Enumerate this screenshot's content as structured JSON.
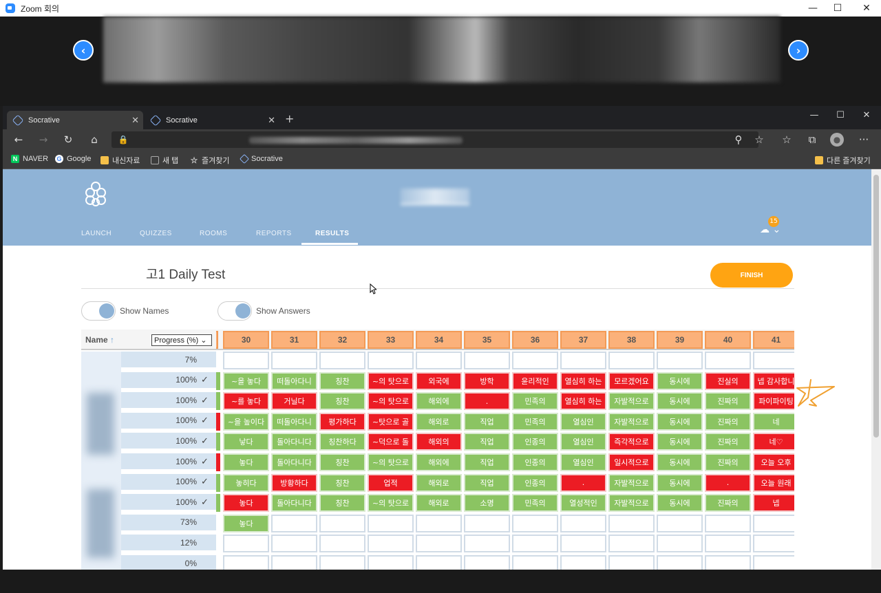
{
  "zoom": {
    "title": "Zoom 회의",
    "window_controls": {
      "minimize": "—",
      "maximize": "☐",
      "close": "✕"
    },
    "nav_prev": "‹",
    "nav_next": "›"
  },
  "browser": {
    "tabs": [
      {
        "label": "Socrative",
        "active": true
      },
      {
        "label": "Socrative",
        "active": false
      }
    ],
    "new_tab": "+",
    "toolbar_icons": [
      "back-icon",
      "forward-icon",
      "refresh-icon",
      "home-icon",
      "lock-icon",
      "search-icon",
      "star-icon",
      "favorites-icon",
      "collections-icon",
      "profile-icon",
      "more-icon"
    ],
    "bookmarks": [
      {
        "label": "NAVER",
        "icon": "naver-icon",
        "color": "#03c75a"
      },
      {
        "label": "Google",
        "icon": "google-icon",
        "color": "#4285f4"
      },
      {
        "label": "내신자료",
        "icon": "folder-icon",
        "color": "#f5c04a"
      },
      {
        "label": "새 탭",
        "icon": "newtab-icon",
        "color": "#aaaaaa"
      },
      {
        "label": "즐겨찾기",
        "icon": "star-icon",
        "color": "#cccccc"
      },
      {
        "label": "Socrative",
        "icon": "socrative-icon",
        "color": "#8ab4f8"
      }
    ],
    "other_bookmarks": "다른 즐겨찾기"
  },
  "socrative": {
    "nav": [
      {
        "label": "LAUNCH",
        "active": false
      },
      {
        "label": "QUIZZES",
        "active": false
      },
      {
        "label": "ROOMS",
        "active": false
      },
      {
        "label": "REPORTS",
        "active": false
      },
      {
        "label": "RESULTS",
        "active": true
      }
    ],
    "badge_count": "15",
    "quiz_title": "고1 Daily Test",
    "finish_label": "FINISH",
    "toggles": [
      {
        "label": "Show Names",
        "on": true
      },
      {
        "label": "Show Answers",
        "on": true
      }
    ],
    "grid": {
      "name_header": "Name",
      "sort_icon": "↑",
      "progress_select": "Progress (%)",
      "questions": [
        "30",
        "31",
        "32",
        "33",
        "34",
        "35",
        "36",
        "37",
        "38",
        "39",
        "40",
        "41"
      ],
      "rows": [
        {
          "progress": "7%",
          "check": false,
          "edge": "",
          "cells": [
            [
              "",
              ""
            ],
            [
              "",
              ""
            ],
            [
              "",
              ""
            ],
            [
              "",
              ""
            ],
            [
              "",
              ""
            ],
            [
              "",
              ""
            ],
            [
              "",
              ""
            ],
            [
              "",
              ""
            ],
            [
              "",
              ""
            ],
            [
              "",
              ""
            ],
            [
              "",
              ""
            ],
            [
              "",
              ""
            ]
          ]
        },
        {
          "progress": "100%",
          "check": true,
          "edge": "correct",
          "cells": [
            [
              "~을 놓다",
              "c"
            ],
            [
              "떠돌아다니",
              "c"
            ],
            [
              "칭찬",
              "c"
            ],
            [
              "~의 탓으로",
              "w"
            ],
            [
              "외국에",
              "w"
            ],
            [
              "방학",
              "w"
            ],
            [
              "윤리적인",
              "w"
            ],
            [
              "열심히 하는",
              "w"
            ],
            [
              "모르겠어요",
              "w"
            ],
            [
              "동시에",
              "c"
            ],
            [
              "진실의",
              "w"
            ],
            [
              "넵 감사합니",
              "w"
            ]
          ]
        },
        {
          "progress": "100%",
          "check": true,
          "edge": "correct",
          "cells": [
            [
              "~를 놓다",
              "w"
            ],
            [
              "거닐다",
              "w"
            ],
            [
              "칭찬",
              "c"
            ],
            [
              "~의 탓으로",
              "w"
            ],
            [
              "해외에",
              "c"
            ],
            [
              ".",
              "w"
            ],
            [
              "민족의",
              "c"
            ],
            [
              "열심히 하는",
              "w"
            ],
            [
              "자발적으로",
              "c"
            ],
            [
              "동시에",
              "c"
            ],
            [
              "진짜의",
              "c"
            ],
            [
              "파이파이팅",
              "w"
            ]
          ]
        },
        {
          "progress": "100%",
          "check": true,
          "edge": "wrong",
          "cells": [
            [
              "~을 높이다",
              "c"
            ],
            [
              "떠돌아다니",
              "c"
            ],
            [
              "평가하다",
              "w"
            ],
            [
              "~탓으로 골",
              "w"
            ],
            [
              "해외로",
              "c"
            ],
            [
              "직업",
              "c"
            ],
            [
              "민족의",
              "c"
            ],
            [
              "열심인",
              "c"
            ],
            [
              "자발적으로",
              "c"
            ],
            [
              "동시에",
              "c"
            ],
            [
              "진짜의",
              "c"
            ],
            [
              "네",
              "c"
            ]
          ]
        },
        {
          "progress": "100%",
          "check": true,
          "edge": "correct",
          "cells": [
            [
              "낳다",
              "c"
            ],
            [
              "돌아다니다",
              "c"
            ],
            [
              "칭찬하다",
              "c"
            ],
            [
              "~덕으로 돌",
              "w"
            ],
            [
              "해외의",
              "w"
            ],
            [
              "직업",
              "c"
            ],
            [
              "인종의",
              "c"
            ],
            [
              "열심인",
              "c"
            ],
            [
              "즉각적으로",
              "w"
            ],
            [
              "동시에",
              "c"
            ],
            [
              "진짜의",
              "c"
            ],
            [
              "네♡",
              "w"
            ]
          ]
        },
        {
          "progress": "100%",
          "check": true,
          "edge": "wrong",
          "cells": [
            [
              "놓다",
              "c"
            ],
            [
              "돌아다니다",
              "c"
            ],
            [
              "칭찬",
              "c"
            ],
            [
              "~의 탓으로",
              "c"
            ],
            [
              "해외에",
              "c"
            ],
            [
              "직업",
              "c"
            ],
            [
              "인종의",
              "c"
            ],
            [
              "열심인",
              "c"
            ],
            [
              "일시적으로",
              "w"
            ],
            [
              "동시에",
              "c"
            ],
            [
              "진짜의",
              "c"
            ],
            [
              "오늘 오후",
              "w"
            ]
          ]
        },
        {
          "progress": "100%",
          "check": true,
          "edge": "correct",
          "cells": [
            [
              "놓히다",
              "c"
            ],
            [
              "방황하다",
              "w"
            ],
            [
              "칭찬",
              "c"
            ],
            [
              "업적",
              "w"
            ],
            [
              "해외로",
              "c"
            ],
            [
              "직업",
              "c"
            ],
            [
              "인종의",
              "c"
            ],
            [
              ".",
              "w"
            ],
            [
              "자발적으로",
              "c"
            ],
            [
              "동시에",
              "c"
            ],
            [
              ".",
              "w"
            ],
            [
              "오늘 원래",
              "w"
            ]
          ]
        },
        {
          "progress": "100%",
          "check": true,
          "edge": "correct",
          "cells": [
            [
              "놓다",
              "w"
            ],
            [
              "돌아다니다",
              "c"
            ],
            [
              "칭찬",
              "c"
            ],
            [
              "~의 탓으로",
              "c"
            ],
            [
              "해외로",
              "c"
            ],
            [
              "소명",
              "c"
            ],
            [
              "민족의",
              "c"
            ],
            [
              "열성적인",
              "c"
            ],
            [
              "자발적으로",
              "c"
            ],
            [
              "동시에",
              "c"
            ],
            [
              "진짜의",
              "c"
            ],
            [
              "넵",
              "w"
            ]
          ]
        },
        {
          "progress": "73%",
          "check": false,
          "edge": "",
          "cells": [
            [
              "놓다",
              "c"
            ],
            [
              "",
              ""
            ],
            [
              "",
              ""
            ],
            [
              "",
              ""
            ],
            [
              "",
              ""
            ],
            [
              "",
              ""
            ],
            [
              "",
              ""
            ],
            [
              "",
              ""
            ],
            [
              "",
              ""
            ],
            [
              "",
              ""
            ],
            [
              "",
              ""
            ],
            [
              "",
              ""
            ]
          ]
        },
        {
          "progress": "12%",
          "check": false,
          "edge": "",
          "cells": [
            [
              "",
              ""
            ],
            [
              "",
              ""
            ],
            [
              "",
              ""
            ],
            [
              "",
              ""
            ],
            [
              "",
              ""
            ],
            [
              "",
              ""
            ],
            [
              "",
              ""
            ],
            [
              "",
              ""
            ],
            [
              "",
              ""
            ],
            [
              "",
              ""
            ],
            [
              "",
              ""
            ],
            [
              "",
              ""
            ]
          ]
        },
        {
          "progress": "0%",
          "check": false,
          "edge": "",
          "cells": [
            [
              "",
              ""
            ],
            [
              "",
              ""
            ],
            [
              "",
              ""
            ],
            [
              "",
              ""
            ],
            [
              "",
              ""
            ],
            [
              "",
              ""
            ],
            [
              "",
              ""
            ],
            [
              "",
              ""
            ],
            [
              "",
              ""
            ],
            [
              "",
              ""
            ],
            [
              "",
              ""
            ],
            [
              "",
              ""
            ]
          ]
        }
      ]
    }
  },
  "colors": {
    "header": "#8fb3d6",
    "finish": "#ffa412",
    "correct": "#8bc462",
    "wrong": "#ec1c24",
    "question_header": "#fbb17a",
    "annotation_star": "#f0a030"
  }
}
